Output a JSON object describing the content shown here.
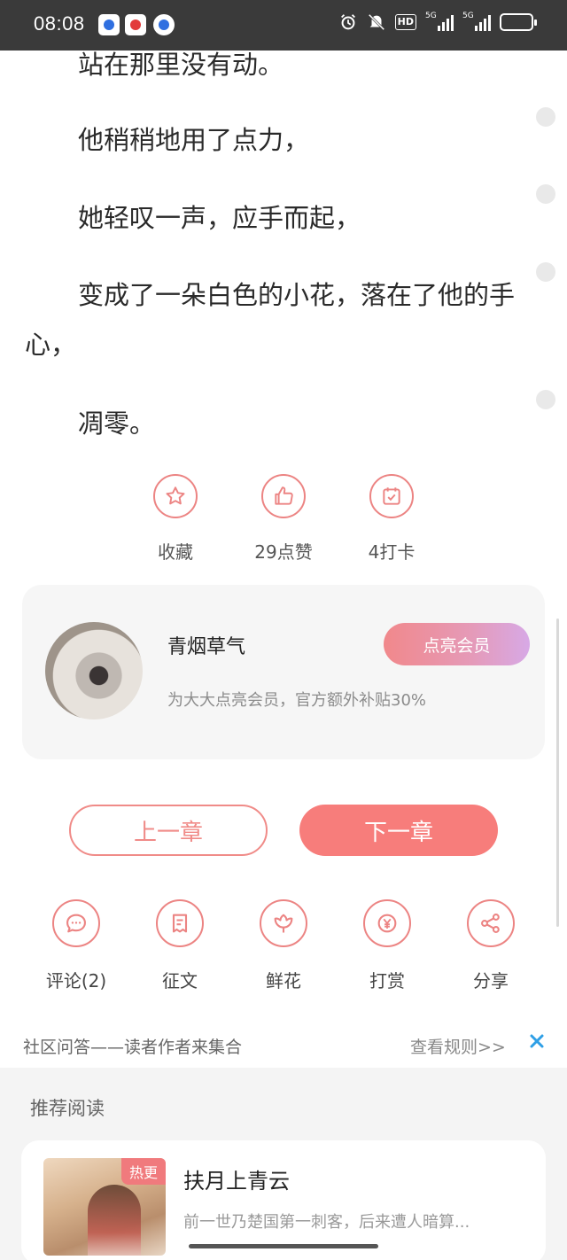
{
  "status_bar": {
    "time": "08:08",
    "icons": [
      "baidu-app-icon",
      "baidu-red-app-icon",
      "browser-app-icon",
      "alarm-icon",
      "mute-icon",
      "hd-icon",
      "5g-signal-icon",
      "5g-signal-icon",
      "battery-icon"
    ],
    "hd_label": "HD",
    "net1": "5G",
    "net2": "5G",
    "battery_fraction": 0.8,
    "battery_color": "#f1b531"
  },
  "reader": {
    "paragraphs": [
      "站在那里没有动。",
      "他稍稍地用了点力，",
      "她轻叹一声，应手而起，",
      "变成了一朵白色的小花，落在了他的手心，",
      "凋零。"
    ]
  },
  "reactions": [
    {
      "icon": "star-icon",
      "label": "收藏"
    },
    {
      "icon": "thumbs-up-icon",
      "label": "29点赞"
    },
    {
      "icon": "calendar-check-icon",
      "label": "4打卡"
    }
  ],
  "author": {
    "name": "青烟草气",
    "subtitle": "为大大点亮会员，官方额外补贴30%",
    "vip_button": "点亮会员"
  },
  "chapter_nav": {
    "prev": "上一章",
    "next": "下一章"
  },
  "actions": [
    {
      "icon": "comment-icon",
      "label": "评论(2)"
    },
    {
      "icon": "document-icon",
      "label": "征文"
    },
    {
      "icon": "flower-icon",
      "label": "鲜花"
    },
    {
      "icon": "yen-icon",
      "label": "打赏"
    },
    {
      "icon": "share-icon",
      "label": "分享"
    }
  ],
  "community": {
    "text": "社区问答——读者作者来集合",
    "rule_link": "查看规则>>",
    "close_icon": "close-icon"
  },
  "recommend": {
    "title": "推荐阅读",
    "book": {
      "tag": "热更",
      "title": "扶月上青云",
      "desc": "前一世乃楚国第一刺客，后来遭人暗算..."
    }
  },
  "colors": {
    "accent": "#f77d7b",
    "accent_border": "#ec8483",
    "status_bar_bg": "#3a3a3a"
  }
}
